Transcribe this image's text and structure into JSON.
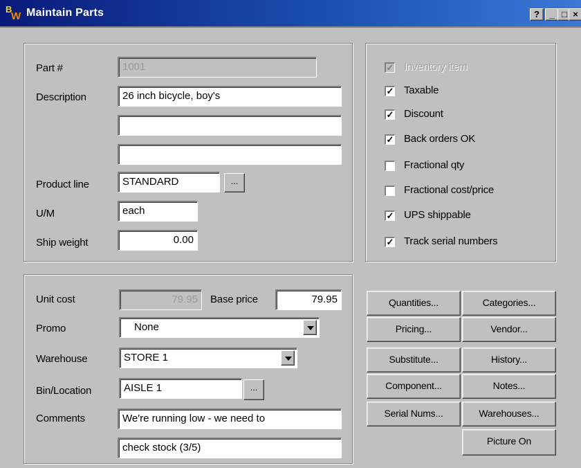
{
  "window": {
    "app_icon": {
      "letter1": "B",
      "letter2": "W"
    },
    "title": "Maintain Parts",
    "controls": {
      "help": "?",
      "minimize": "_",
      "maximize": "□",
      "close": "×"
    }
  },
  "part_info": {
    "part_no": {
      "label": "Part #",
      "value": "1001"
    },
    "description": {
      "label": "Description",
      "lines": [
        "26 inch bicycle, boy's",
        "",
        ""
      ]
    },
    "product_line": {
      "label": "Product line",
      "value": "STANDARD",
      "lookup": "..."
    },
    "um": {
      "label": "U/M",
      "value": "each"
    },
    "ship_weight": {
      "label": "Ship weight",
      "value": "0.00"
    }
  },
  "flags": [
    {
      "label": "Inventory item",
      "checked": true,
      "disabled": true
    },
    {
      "label": "Taxable",
      "checked": true,
      "disabled": false
    },
    {
      "label": "Discount",
      "checked": true,
      "disabled": false
    },
    {
      "label": "Back orders OK",
      "checked": true,
      "disabled": false
    },
    {
      "label": "Fractional qty",
      "checked": false,
      "disabled": false
    },
    {
      "label": "Fractional cost/price",
      "checked": false,
      "disabled": false
    },
    {
      "label": "UPS shippable",
      "checked": true,
      "disabled": false
    },
    {
      "label": "Track serial numbers",
      "checked": true,
      "disabled": false
    }
  ],
  "pricing": {
    "unit_cost": {
      "label": "Unit cost",
      "value": "79.95"
    },
    "base_price": {
      "label": "Base price",
      "value": "79.95"
    },
    "promo": {
      "label": "Promo",
      "value": "None"
    },
    "warehouse": {
      "label": "Warehouse",
      "value": "STORE 1"
    },
    "bin_location": {
      "label": "Bin/Location",
      "value": "AISLE 1",
      "lookup": "..."
    },
    "comments": {
      "label": "Comments",
      "lines": [
        "We're running low - we need to",
        "check stock (3/5)"
      ]
    }
  },
  "buttons": {
    "quantities": "Quantities...",
    "categories": "Categories...",
    "pricing": "Pricing...",
    "vendor": "Vendor...",
    "substitute": "Substitute...",
    "history": "History...",
    "component": "Component...",
    "notes": "Notes...",
    "serial_nums": "Serial Nums...",
    "warehouses": "Warehouses...",
    "picture_on": "Picture On"
  },
  "colors": {
    "titlebar_start": "#0a1a7a",
    "titlebar_end": "#3c78d8",
    "face": "#c0c0c0"
  }
}
